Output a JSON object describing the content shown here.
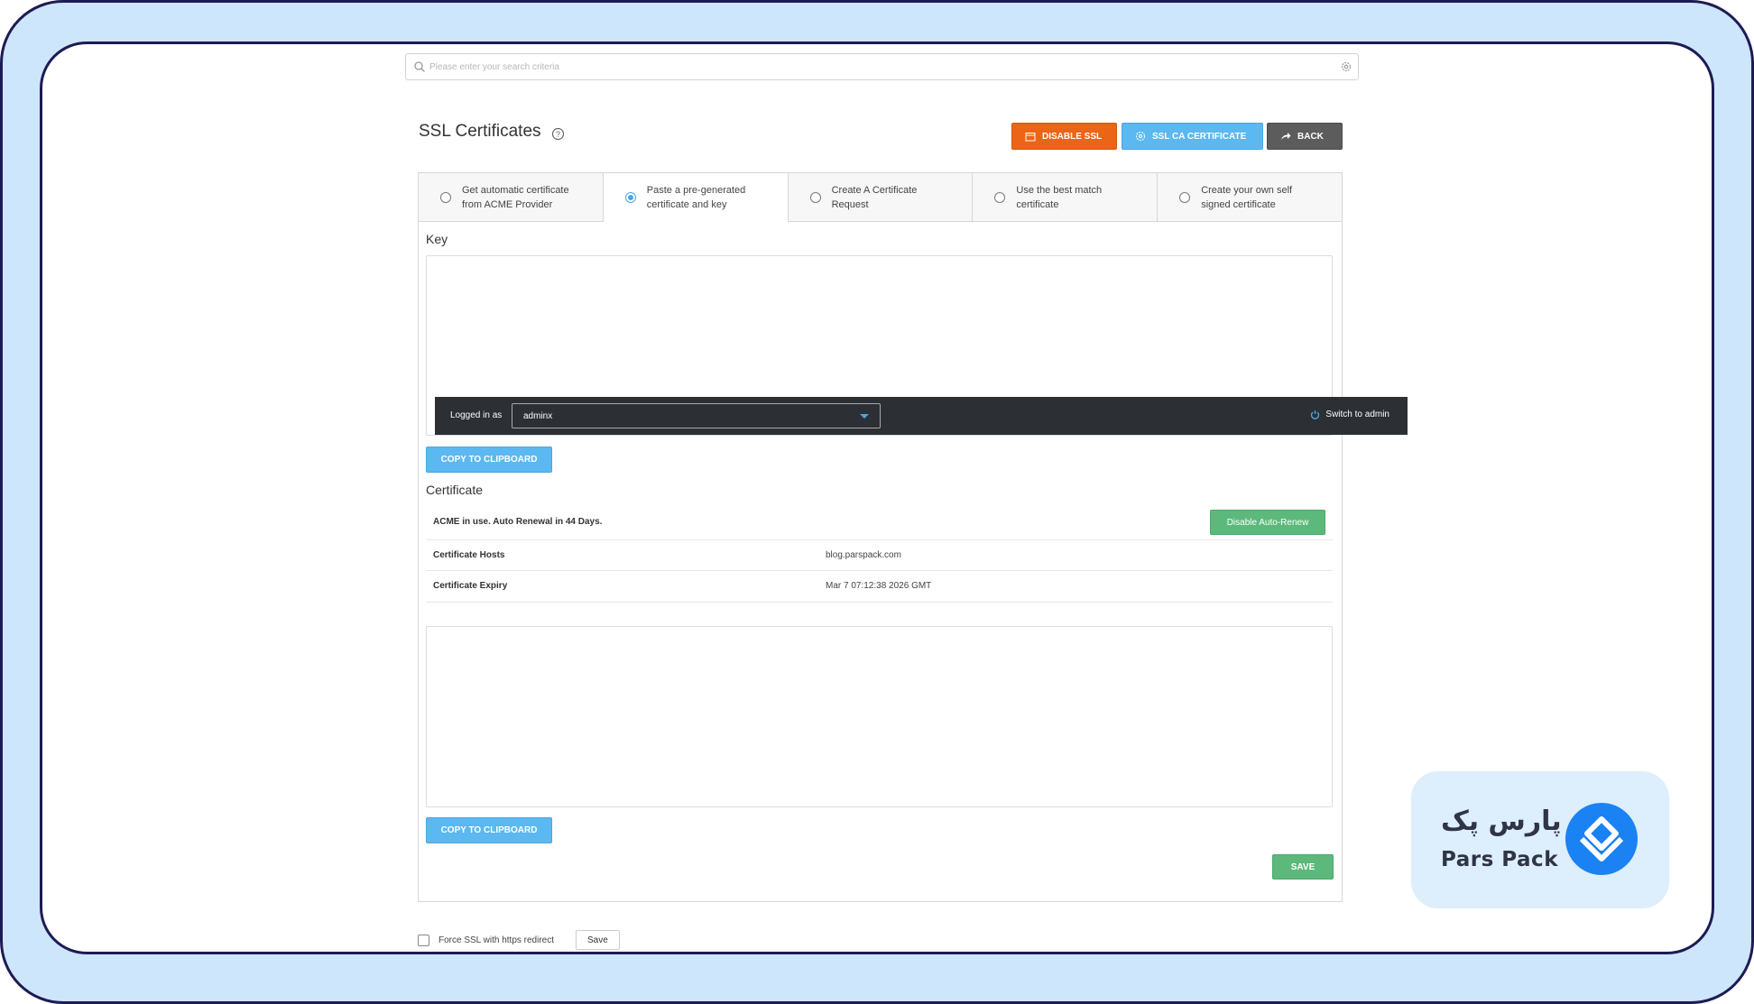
{
  "search": {
    "placeholder": "Please enter your search criteria"
  },
  "header": {
    "title": "SSL Certificates"
  },
  "toolbar": {
    "disable_ssl": "DISABLE SSL",
    "ssl_ca_certificate": "SSL CA CERTIFICATE",
    "back": "BACK"
  },
  "tabs": [
    {
      "label": "Get automatic certificate from ACME Provider",
      "selected": false
    },
    {
      "label": "Paste a pre-generated certificate and key",
      "selected": true
    },
    {
      "label": "Create A Certificate Request",
      "selected": false
    },
    {
      "label": "Use the best match certificate",
      "selected": false
    },
    {
      "label": "Create your own self signed certificate",
      "selected": false
    }
  ],
  "key_section": {
    "label": "Key",
    "value": "",
    "copy_label": "COPY TO CLIPBOARD"
  },
  "certificate_section": {
    "label": "Certificate",
    "acme_status": "ACME in use. Auto Renewal in 44 Days.",
    "disable_autorenew": "Disable Auto-Renew",
    "rows": [
      {
        "label": "Certificate Hosts",
        "value": "blog.parspack.com"
      },
      {
        "label": "Certificate Expiry",
        "value": "Mar 7 07:12:38 2026 GMT"
      }
    ],
    "value": "",
    "copy_label": "COPY TO CLIPBOARD"
  },
  "save_label": "SAVE",
  "force_ssl": {
    "label": "Force SSL with https redirect",
    "checked": false,
    "save_label": "Save"
  },
  "admin_bar": {
    "logged_in_label": "Logged in as",
    "user": "adminx",
    "switch_label": "Switch to admin"
  },
  "logo": {
    "text_fa": "پارس پک",
    "text_en": "Pars Pack"
  },
  "colors": {
    "orange": "#ec6416",
    "blue": "#5bb8f0",
    "grey": "#5c5c5c",
    "green": "#5cb97b",
    "frame": "#1e1b54",
    "frame_bg": "#cde6fc",
    "brand_blue": "#1a82f2"
  }
}
